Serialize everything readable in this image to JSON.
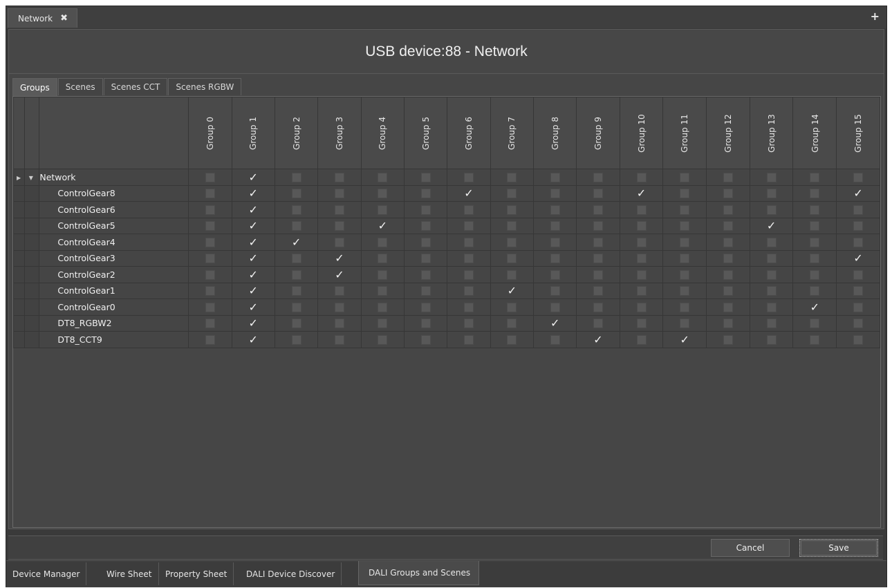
{
  "top_tab": {
    "label": "Network",
    "close_symbol": "✖",
    "add_symbol": "+"
  },
  "panel": {
    "title": "USB device:88 - Network"
  },
  "tabs": [
    {
      "label": "Groups",
      "active": true
    },
    {
      "label": "Scenes",
      "active": false
    },
    {
      "label": "Scenes CCT",
      "active": false
    },
    {
      "label": "Scenes RGBW",
      "active": false
    }
  ],
  "grid": {
    "columns": [
      "Group 0",
      "Group 1",
      "Group 2",
      "Group 3",
      "Group 4",
      "Group 5",
      "Group 6",
      "Group 7",
      "Group 8",
      "Group 9",
      "Group 10",
      "Group 11",
      "Group 12",
      "Group 13",
      "Group 14",
      "Group 15"
    ],
    "rows": [
      {
        "name": "Network",
        "root": true,
        "checked": [
          1
        ]
      },
      {
        "name": "ControlGear8",
        "checked": [
          1,
          6,
          10,
          15
        ]
      },
      {
        "name": "ControlGear6",
        "checked": [
          1
        ]
      },
      {
        "name": "ControlGear5",
        "checked": [
          1,
          4,
          13
        ]
      },
      {
        "name": "ControlGear4",
        "checked": [
          1,
          2
        ]
      },
      {
        "name": "ControlGear3",
        "checked": [
          1,
          3,
          15
        ]
      },
      {
        "name": "ControlGear2",
        "checked": [
          1,
          3
        ]
      },
      {
        "name": "ControlGear1",
        "checked": [
          1,
          7
        ]
      },
      {
        "name": "ControlGear0",
        "checked": [
          1,
          14
        ]
      },
      {
        "name": "DT8_RGBW2",
        "checked": [
          1,
          8
        ]
      },
      {
        "name": "DT8_CCT9",
        "checked": [
          1,
          9,
          11
        ]
      }
    ]
  },
  "footer": {
    "cancel_label": "Cancel",
    "save_label": "Save"
  },
  "bottom_tabs": [
    {
      "label": "Device Manager",
      "active": false
    },
    {
      "label": "Wire Sheet",
      "active": false
    },
    {
      "label": "Property Sheet",
      "active": false
    },
    {
      "label": "DALI Device Discover",
      "active": false
    },
    {
      "label": "DALI Groups and Scenes",
      "active": true
    }
  ],
  "colors": {
    "background": "#3a3a3a",
    "panel": "#464646",
    "text": "#e6e6e6"
  }
}
